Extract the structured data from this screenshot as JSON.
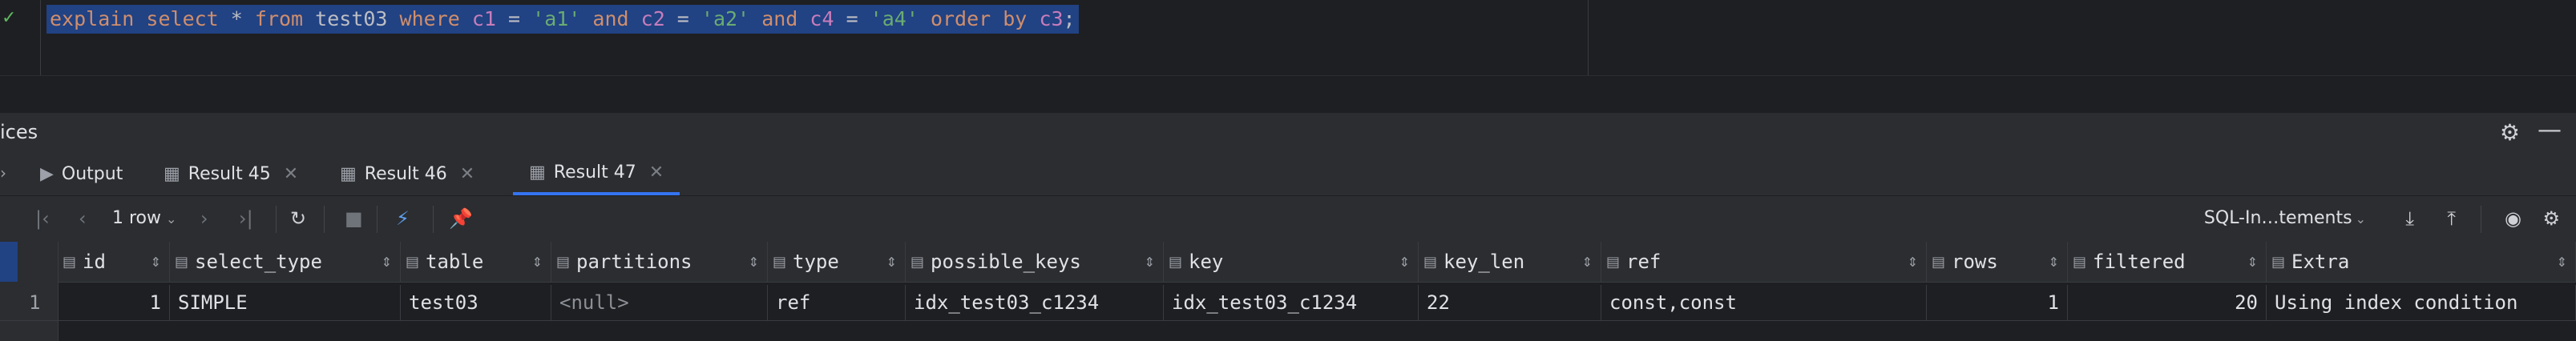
{
  "editor": {
    "tokens": [
      {
        "t": "explain",
        "c": "kw"
      },
      {
        "t": " ",
        "c": "pn"
      },
      {
        "t": "select",
        "c": "kw"
      },
      {
        "t": " * ",
        "c": "pn"
      },
      {
        "t": "from",
        "c": "kw"
      },
      {
        "t": " ",
        "c": "pn"
      },
      {
        "t": "test03",
        "c": "id"
      },
      {
        "t": " ",
        "c": "pn"
      },
      {
        "t": "where",
        "c": "kw"
      },
      {
        "t": " ",
        "c": "pn"
      },
      {
        "t": "c1",
        "c": "fld"
      },
      {
        "t": " = ",
        "c": "pn"
      },
      {
        "t": "'a1'",
        "c": "str"
      },
      {
        "t": " ",
        "c": "pn"
      },
      {
        "t": "and",
        "c": "kw"
      },
      {
        "t": " ",
        "c": "pn"
      },
      {
        "t": "c2",
        "c": "fld"
      },
      {
        "t": " = ",
        "c": "pn"
      },
      {
        "t": "'a2'",
        "c": "str"
      },
      {
        "t": " ",
        "c": "pn"
      },
      {
        "t": "and",
        "c": "kw"
      },
      {
        "t": " ",
        "c": "pn"
      },
      {
        "t": "c4",
        "c": "fld"
      },
      {
        "t": " = ",
        "c": "pn"
      },
      {
        "t": "'a4'",
        "c": "str"
      },
      {
        "t": " ",
        "c": "pn"
      },
      {
        "t": "order by",
        "c": "kw"
      },
      {
        "t": " ",
        "c": "pn"
      },
      {
        "t": "c3",
        "c": "fld"
      },
      {
        "t": ";",
        "c": "pn"
      }
    ]
  },
  "services": {
    "title": "ices"
  },
  "tabs": [
    {
      "label": "Output",
      "icon": "output-icon"
    },
    {
      "label": "Result 45",
      "icon": "table-icon"
    },
    {
      "label": "Result 46",
      "icon": "table-icon"
    },
    {
      "label": "Result 47",
      "icon": "table-icon",
      "active": true
    }
  ],
  "toolbar": {
    "rows_label": "1 row",
    "session_label": "SQL-In…tements"
  },
  "grid": {
    "columns": [
      "id",
      "select_type",
      "table",
      "partitions",
      "type",
      "possible_keys",
      "key",
      "key_len",
      "ref",
      "rows",
      "filtered",
      "Extra"
    ],
    "rows": [
      {
        "num": "1",
        "cells": [
          "1",
          "SIMPLE",
          "test03",
          "<null>",
          "ref",
          "idx_test03_c1234",
          "idx_test03_c1234",
          "22",
          "const,const",
          "1",
          "20",
          "Using index condition"
        ]
      }
    ]
  },
  "colors": {
    "editor_bg": "#1e1f22",
    "panel_bg": "#2b2d30",
    "selection": "#214283",
    "keyword": "#cf8e6d",
    "string": "#6aab73",
    "field": "#c77dbb",
    "accent": "#3574f0"
  }
}
